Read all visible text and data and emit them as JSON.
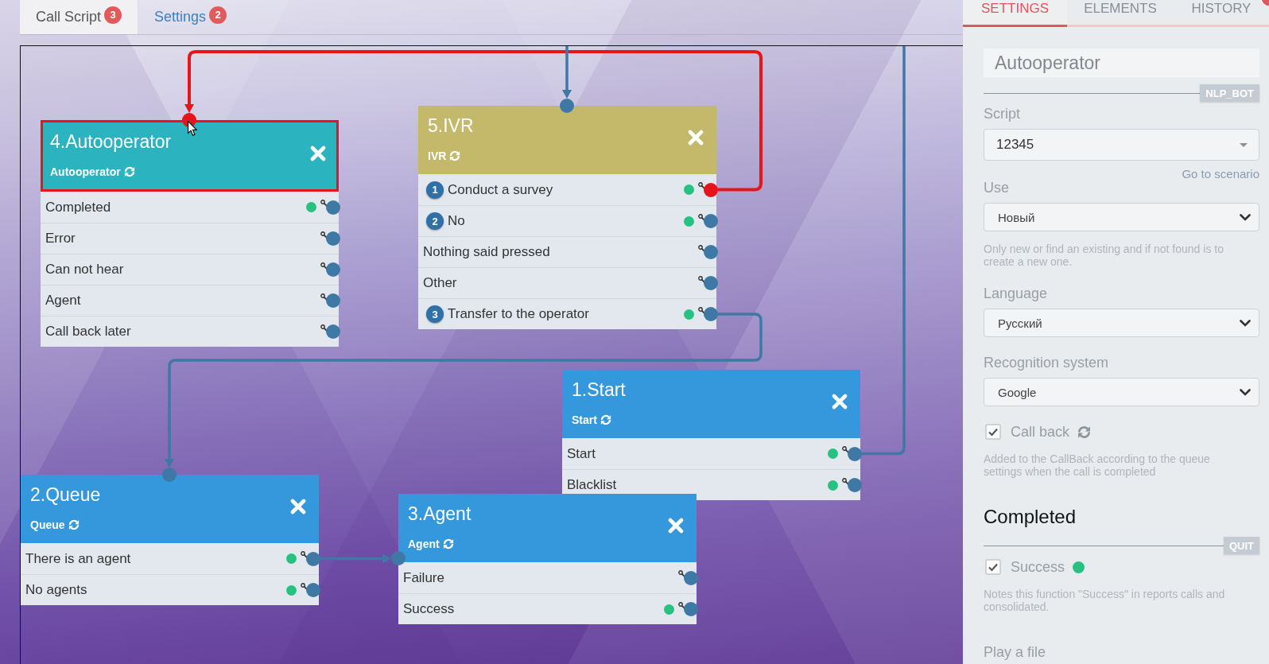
{
  "tabs": [
    {
      "label": "Call Script",
      "badge": "3",
      "selected": true
    },
    {
      "label": "Settings",
      "badge": "2",
      "selected": false
    }
  ],
  "canvas": {
    "nodes": [
      {
        "title": "4.Autooperator",
        "type": "Autooperator",
        "color": "#2bb4c0",
        "selected": true,
        "rows": [
          {
            "label": "Completed",
            "success": true,
            "link_selected": false
          },
          {
            "label": "Error",
            "success": false,
            "link_selected": false
          },
          {
            "label": "Can not hear",
            "success": false,
            "link_selected": false
          },
          {
            "label": "Agent",
            "success": false,
            "link_selected": false
          },
          {
            "label": "Call back later",
            "success": false,
            "link_selected": false
          }
        ]
      },
      {
        "title": "5.IVR",
        "type": "IVR",
        "color": "#c4b86a",
        "selected": false,
        "rows": [
          {
            "number": "1",
            "label": "Conduct a survey",
            "success": true,
            "link_selected": true
          },
          {
            "number": "2",
            "label": "No",
            "success": true,
            "link_selected": false
          },
          {
            "label": "Nothing said pressed",
            "success": false,
            "link_selected": false
          },
          {
            "label": "Other",
            "success": false,
            "link_selected": false
          },
          {
            "number": "3",
            "label": "Transfer to the operator",
            "success": true,
            "link_selected": false
          }
        ]
      },
      {
        "title": "1.Start",
        "type": "Start",
        "color": "#3598dc",
        "selected": false,
        "rows": [
          {
            "label": "Start",
            "success": true,
            "link_selected": false
          },
          {
            "label": "Blacklist",
            "success": true,
            "link_selected": false
          }
        ]
      },
      {
        "title": "2.Queue",
        "type": "Queue",
        "color": "#3598dc",
        "selected": false,
        "rows": [
          {
            "label": "There is an agent",
            "success": true,
            "link_selected": false
          },
          {
            "label": "No agents",
            "success": true,
            "link_selected": false
          }
        ]
      },
      {
        "title": "3.Agent",
        "type": "Agent",
        "color": "#3598dc",
        "selected": false,
        "rows": [
          {
            "label": "Failure",
            "success": false,
            "link_selected": false
          },
          {
            "label": "Success",
            "success": true,
            "link_selected": false
          }
        ]
      }
    ]
  },
  "side_panel": {
    "tabs": [
      {
        "label": "SETTINGS",
        "selected": true,
        "notification": false
      },
      {
        "label": "ELEMENTS",
        "selected": false,
        "notification": false
      },
      {
        "label": "HISTORY",
        "selected": false,
        "notification": true
      }
    ],
    "name": "Autooperator",
    "type_badge": "NLP_BOT",
    "script": {
      "label": "Script",
      "value": "12345",
      "link": "Go to scenario"
    },
    "selects": [
      {
        "label": "Use",
        "value": "Новый",
        "hint": "Only new or find an existing and if not found is to create a new one."
      },
      {
        "label": "Language",
        "value": "Русский"
      },
      {
        "label": "Recognition system",
        "value": "Google"
      }
    ],
    "callback": {
      "label": "Call back",
      "checked": true,
      "hint": "Added to the CallBack according to the queue settings when the call is completed"
    },
    "result": {
      "title": "Completed",
      "badge": "QUIT",
      "option": {
        "label": "Success",
        "checked": true,
        "hint": "Notes this function \"Success\" in reports calls and consolidated."
      }
    },
    "next_label": "Play a file"
  }
}
